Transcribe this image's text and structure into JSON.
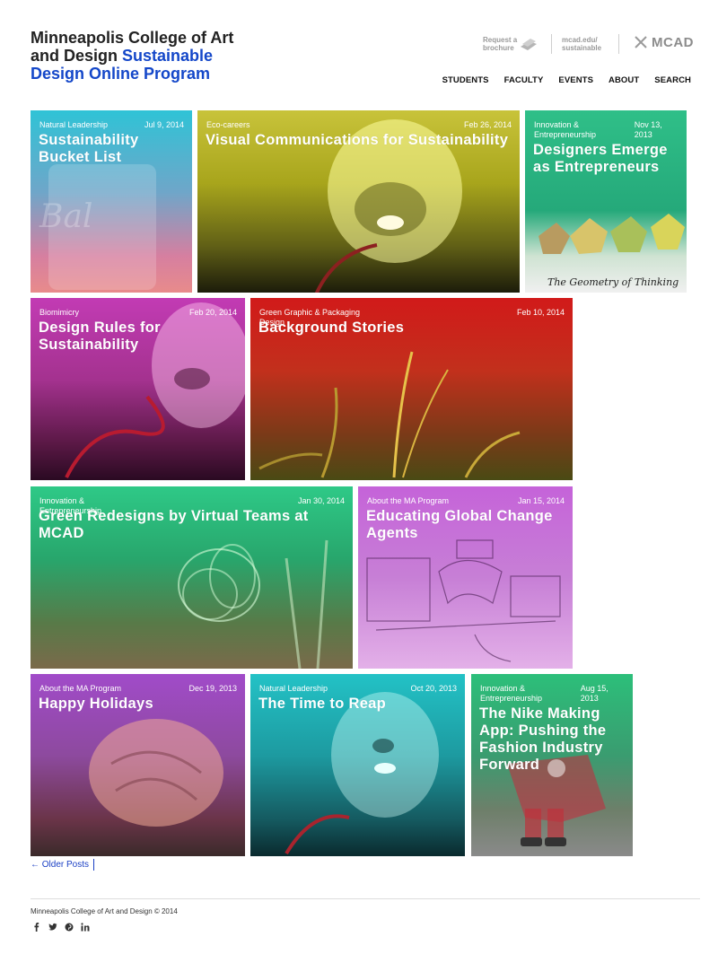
{
  "site": {
    "title_line1": "Minneapolis College of Art",
    "title_line2a": "and Design",
    "title_line2b": "Sustainable",
    "title_line3": "Design Online Program"
  },
  "utility": {
    "brochure_line1": "Request a",
    "brochure_line2": "brochure",
    "url_line1": "mcad.edu/",
    "url_line2": "sustainable",
    "logo_text": "MCAD"
  },
  "nav": [
    "STUDENTS",
    "FACULTY",
    "EVENTS",
    "ABOUT",
    "SEARCH"
  ],
  "posts": [
    {
      "category": "Natural Leadership",
      "date": "Jul 9, 2014",
      "title": "Sustainability Bucket List"
    },
    {
      "category": "Eco-careers",
      "date": "Feb 26, 2014",
      "title": "Visual Communications for Sustainability"
    },
    {
      "category": "Innovation & Entrepreneurship",
      "date": "Nov 13, 2013",
      "title": "Designers Emerge as Entrepreneurs",
      "caption": "The Geometry of Thinking"
    },
    {
      "category": "Biomimicry",
      "date": "Feb 20, 2014",
      "title": "Design Rules for Sustainability"
    },
    {
      "category": "Green Graphic & Packaging Design",
      "date": "Feb 10, 2014",
      "title": "Background Stories"
    },
    {
      "category": "Innovation & Entrepreneurship",
      "date": "Jan 30, 2014",
      "title": "Green Redesigns by Virtual Teams at MCAD"
    },
    {
      "category": "About the MA Program",
      "date": "Jan 15, 2014",
      "title": "Educating Global Change Agents"
    },
    {
      "category": "About the MA Program",
      "date": "Dec 19, 2013",
      "title": "Happy Holidays"
    },
    {
      "category": "Natural Leadership",
      "date": "Oct 20, 2013",
      "title": "The Time to Reap"
    },
    {
      "category": "Innovation & Entrepreneurship",
      "date": "Aug 15, 2013",
      "title": "The Nike Making App: Pushing the Fashion Industry Forward"
    }
  ],
  "footer": {
    "older_posts": "← Older Posts",
    "copyright": "Minneapolis College of Art and Design © 2014"
  },
  "social_icons": [
    "facebook-icon",
    "twitter-icon",
    "pinterest-icon",
    "linkedin-icon"
  ],
  "colors": {
    "accent": "#1447c9",
    "link": "#1a3fc4"
  }
}
